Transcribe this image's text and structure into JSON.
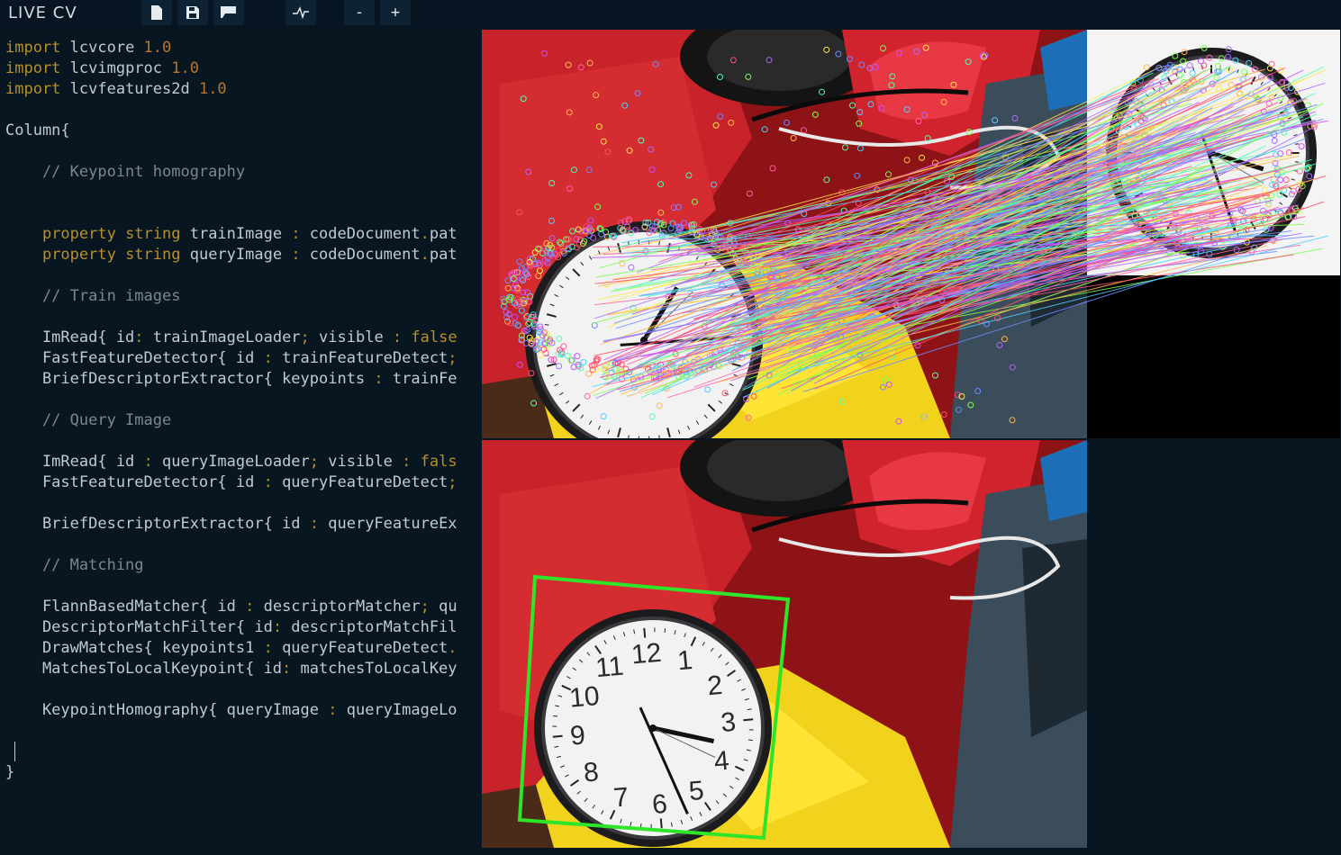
{
  "app": {
    "logo": "LIVE CV"
  },
  "toolbar": {
    "new_icon": "new-document-icon",
    "save_icon": "save-icon",
    "open_icon": "open-folder-icon",
    "log_icon": "pulse-icon",
    "zoom_out_label": "-",
    "zoom_in_label": "+"
  },
  "editor": {
    "lines": [
      [
        [
          "kw",
          "import "
        ],
        [
          "pl",
          "lcvcore "
        ],
        [
          "num",
          "1.0"
        ]
      ],
      [
        [
          "kw",
          "import "
        ],
        [
          "pl",
          "lcvimgproc "
        ],
        [
          "num",
          "1.0"
        ]
      ],
      [
        [
          "kw",
          "import "
        ],
        [
          "pl",
          "lcvfeatures2d "
        ],
        [
          "num",
          "1.0"
        ]
      ],
      [],
      [
        [
          "pl",
          "Column{"
        ]
      ],
      [],
      [
        [
          "cm",
          "    // Keypoint homography"
        ]
      ],
      [],
      [],
      [
        [
          "pl",
          "    "
        ],
        [
          "kw",
          "property string "
        ],
        [
          "pl",
          "trainImage "
        ],
        [
          "kw",
          ": "
        ],
        [
          "pl",
          "codeDocument"
        ],
        [
          "kw",
          "."
        ],
        [
          "pl",
          "pat"
        ]
      ],
      [
        [
          "pl",
          "    "
        ],
        [
          "kw",
          "property string "
        ],
        [
          "pl",
          "queryImage "
        ],
        [
          "kw",
          ": "
        ],
        [
          "pl",
          "codeDocument"
        ],
        [
          "kw",
          "."
        ],
        [
          "pl",
          "pat"
        ]
      ],
      [],
      [
        [
          "cm",
          "    // Train images"
        ]
      ],
      [],
      [
        [
          "pl",
          "    ImRead{ id"
        ],
        [
          "kw",
          ": "
        ],
        [
          "pl",
          "trainImageLoader"
        ],
        [
          "kw",
          "; "
        ],
        [
          "pl",
          "visible "
        ],
        [
          "kw",
          ": false"
        ]
      ],
      [
        [
          "pl",
          "    FastFeatureDetector{ id "
        ],
        [
          "kw",
          ": "
        ],
        [
          "pl",
          "trainFeatureDetect"
        ],
        [
          "kw",
          ";"
        ]
      ],
      [
        [
          "pl",
          "    BriefDescriptorExtractor{ keypoints "
        ],
        [
          "kw",
          ": "
        ],
        [
          "pl",
          "trainFe"
        ]
      ],
      [],
      [
        [
          "cm",
          "    // Query Image"
        ]
      ],
      [],
      [
        [
          "pl",
          "    ImRead{ id "
        ],
        [
          "kw",
          ": "
        ],
        [
          "pl",
          "queryImageLoader"
        ],
        [
          "kw",
          "; "
        ],
        [
          "pl",
          "visible "
        ],
        [
          "kw",
          ": fals"
        ]
      ],
      [
        [
          "pl",
          "    FastFeatureDetector{ id "
        ],
        [
          "kw",
          ": "
        ],
        [
          "pl",
          "queryFeatureDetect"
        ],
        [
          "kw",
          ";"
        ]
      ],
      [],
      [
        [
          "pl",
          "    BriefDescriptorExtractor{ id "
        ],
        [
          "kw",
          ": "
        ],
        [
          "pl",
          "queryFeatureEx"
        ]
      ],
      [],
      [
        [
          "cm",
          "    // Matching"
        ]
      ],
      [],
      [
        [
          "pl",
          "    FlannBasedMatcher{ id "
        ],
        [
          "kw",
          ": "
        ],
        [
          "pl",
          "descriptorMatcher"
        ],
        [
          "kw",
          "; "
        ],
        [
          "pl",
          "qu"
        ]
      ],
      [
        [
          "pl",
          "    DescriptorMatchFilter{ id"
        ],
        [
          "kw",
          ": "
        ],
        [
          "pl",
          "descriptorMatchFil"
        ]
      ],
      [
        [
          "pl",
          "    DrawMatches{ keypoints1 "
        ],
        [
          "kw",
          ": "
        ],
        [
          "pl",
          "queryFeatureDetect"
        ],
        [
          "kw",
          "."
        ]
      ],
      [
        [
          "pl",
          "    MatchesToLocalKeypoint{ id"
        ],
        [
          "kw",
          ": "
        ],
        [
          "pl",
          "matchesToLocalKey"
        ]
      ],
      [],
      [
        [
          "pl",
          "    KeypointHomography{ queryImage "
        ],
        [
          "kw",
          ": "
        ],
        [
          "pl",
          "queryImageLo"
        ]
      ],
      [],
      [],
      [
        [
          "pl",
          "}"
        ]
      ]
    ]
  },
  "clock": {
    "numbers": [
      "12",
      "1",
      "2",
      "3",
      "4",
      "5",
      "6",
      "7",
      "8",
      "9",
      "10",
      "11"
    ]
  },
  "colors": {
    "background": "#071621",
    "keyword": "#b78f2b",
    "number": "#b7772b",
    "comment": "#7e858d",
    "text": "#c3c9cf",
    "homography_box": "#2fe52a"
  }
}
